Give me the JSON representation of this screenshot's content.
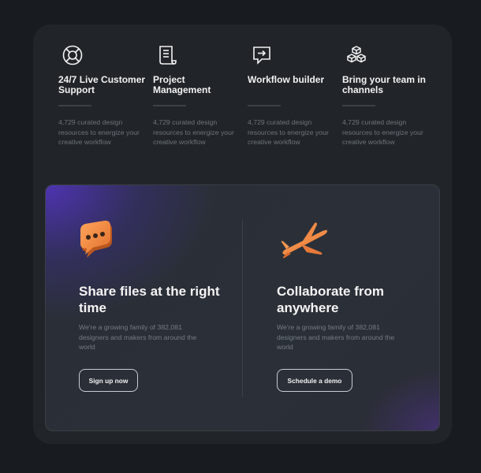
{
  "features": [
    {
      "icon": "lifebuoy-icon",
      "title": "24/7 Live Customer Support",
      "description": "4,729 curated design resources to energize your creative workflow"
    },
    {
      "icon": "document-icon",
      "title": "Project Management",
      "description": "4,729 curated design resources to energize your creative workflow"
    },
    {
      "icon": "arrow-box-icon",
      "title": "Workflow builder",
      "description": "4,729 curated design resources to energize your creative workflow"
    },
    {
      "icon": "cubes-icon",
      "title": "Bring your team in channels",
      "description": "4,729 curated design resources to energize your creative workflow"
    }
  ],
  "cta": [
    {
      "illustration": "chat-bubble-icon",
      "heading": "Share files at the right time",
      "subtitle": "We're a growing family of 382,081 designers and makers from around the world",
      "button": "Sign up now"
    },
    {
      "illustration": "airplane-icon",
      "heading": "Collaborate from anywhere",
      "subtitle": "We're a growing family of 382,081 designers and makers from around the world",
      "button": "Schedule a demo"
    }
  ],
  "colors": {
    "page": "#181b1f",
    "card": "#212529",
    "accent_orange": "#f0873c",
    "gradient_purple": "#5234be"
  }
}
